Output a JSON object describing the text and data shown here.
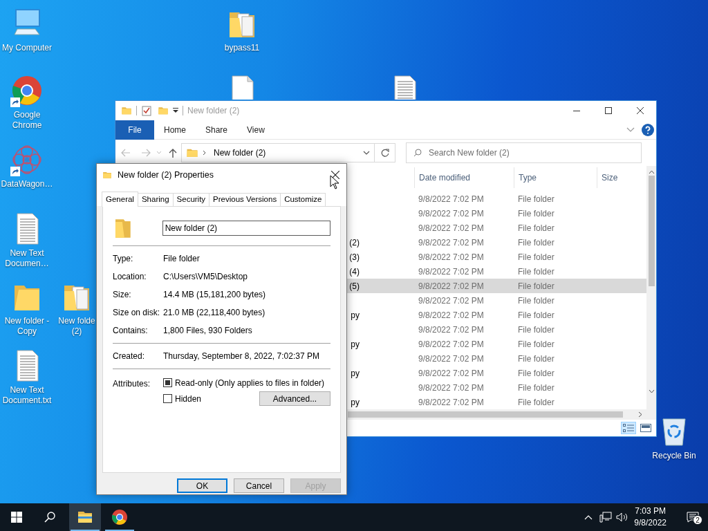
{
  "desktop_icons": [
    {
      "kind": "computer",
      "lines": [
        "My Computer"
      ],
      "shortcut": false
    },
    {
      "kind": "chrome",
      "lines": [
        "Google",
        "Chrome"
      ],
      "shortcut": true
    },
    {
      "kind": "mandala",
      "lines": [
        "DataWagon…"
      ],
      "shortcut": true
    },
    {
      "kind": "textdoc",
      "lines": [
        "New Text",
        "Documen…"
      ],
      "shortcut": false
    },
    {
      "kind": "folder",
      "lines": [
        "New folder -",
        "Copy"
      ],
      "shortcut": false
    },
    {
      "kind": "folderfull",
      "lines": [
        "New folde",
        "(2)"
      ],
      "shortcut": false
    },
    {
      "kind": "textdoc",
      "lines": [
        "New Text",
        "Document.txt"
      ],
      "shortcut": false
    },
    {
      "kind": "folderfull",
      "lines": [
        "bypass11"
      ],
      "shortcut": false
    },
    {
      "kind": "blankdoc",
      "shortcut": false
    },
    {
      "kind": "textdoc",
      "shortcut": false
    },
    {
      "kind": "recycle",
      "lines": [
        "Recycle Bin"
      ],
      "shortcut": false
    }
  ],
  "explorer": {
    "title": "New folder (2)",
    "ribbon_tabs": [
      {
        "label": "File",
        "kind": "menu"
      },
      {
        "label": "Home",
        "kind": "tab"
      },
      {
        "label": "Share",
        "kind": "tab"
      },
      {
        "label": "View",
        "kind": "tab"
      }
    ],
    "address": "New folder (2)",
    "search": {
      "placeholder": "Search New folder (2)"
    },
    "columns": [
      "Date modified",
      "Type",
      "Size"
    ],
    "rows": [
      {
        "date": "9/8/2022 7:02 PM",
        "type": "File folder",
        "selected": false
      },
      {
        "date": "9/8/2022 7:02 PM",
        "type": "File folder",
        "selected": false
      },
      {
        "date": "9/8/2022 7:02 PM",
        "type": "File folder",
        "selected": false
      },
      {
        "name": "(2)",
        "date": "9/8/2022 7:02 PM",
        "type": "File folder",
        "selected": false
      },
      {
        "name": "(3)",
        "date": "9/8/2022 7:02 PM",
        "type": "File folder",
        "selected": false
      },
      {
        "name": "(4)",
        "date": "9/8/2022 7:02 PM",
        "type": "File folder",
        "selected": false
      },
      {
        "name": "(5)",
        "date": "9/8/2022 7:02 PM",
        "type": "File folder",
        "selected": true
      },
      {
        "date": "9/8/2022 7:02 PM",
        "type": "File folder",
        "selected": false
      },
      {
        "name": "py",
        "date": "9/8/2022 7:02 PM",
        "type": "File folder",
        "selected": false
      },
      {
        "date": "9/8/2022 7:02 PM",
        "type": "File folder",
        "selected": false
      },
      {
        "name": "py",
        "date": "9/8/2022 7:02 PM",
        "type": "File folder",
        "selected": false
      },
      {
        "date": "9/8/2022 7:02 PM",
        "type": "File folder",
        "selected": false
      },
      {
        "name": "py",
        "date": "9/8/2022 7:02 PM",
        "type": "File folder",
        "selected": false
      },
      {
        "date": "9/8/2022 7:02 PM",
        "type": "File folder",
        "selected": false
      },
      {
        "name": "py",
        "date": "9/8/2022 7:02 PM",
        "type": "File folder",
        "selected": false
      }
    ]
  },
  "dialog": {
    "title": "New folder (2) Properties",
    "tabs": [
      {
        "label": "General",
        "selected": true
      },
      {
        "label": "Sharing",
        "selected": false
      },
      {
        "label": "Security",
        "selected": false
      },
      {
        "label": "Previous Versions",
        "selected": false
      },
      {
        "label": "Customize",
        "selected": false
      }
    ],
    "name_value": "New folder (2)",
    "groups": [
      [
        {
          "label": "Type:",
          "value": "File folder"
        },
        {
          "label": "Location:",
          "value": "C:\\Users\\VM5\\Desktop"
        },
        {
          "label": "Size:",
          "value": "14.4 MB (15,181,200 bytes)"
        },
        {
          "label": "Size on disk:",
          "value": "21.0 MB (22,118,400 bytes)"
        },
        {
          "label": "Contains:",
          "value": "1,800 Files, 930 Folders"
        }
      ],
      [
        {
          "label": "Created:",
          "value": "Thursday, September 8, 2022, 7:02:37 PM"
        }
      ]
    ],
    "attributes_label": "Attributes:",
    "attributes": [
      {
        "label": "Read-only (Only applies to files in folder)",
        "checked": true
      },
      {
        "label": "Hidden",
        "checked": false
      }
    ],
    "advanced_button": "Advanced...",
    "buttons": [
      {
        "label": "OK",
        "default": true,
        "disabled": false
      },
      {
        "label": "Cancel",
        "default": false,
        "disabled": false
      },
      {
        "label": "Apply",
        "default": false,
        "disabled": true
      }
    ]
  },
  "taskbar": {
    "apps": [
      {
        "kind": "explorer",
        "active": true
      },
      {
        "kind": "chrome",
        "active": false
      }
    ],
    "time": "7:03 PM",
    "date": "9/8/2022",
    "notifications": "2"
  }
}
